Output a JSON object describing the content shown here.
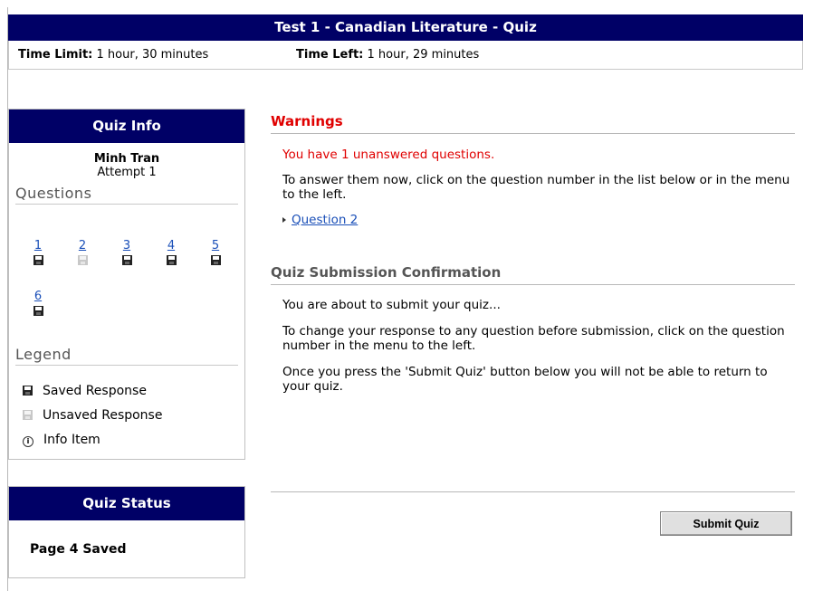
{
  "header": {
    "title": "Test 1 - Canadian Literature - Quiz",
    "time_limit_label": "Time Limit:",
    "time_limit_value": "1 hour, 30 minutes",
    "time_left_label": "Time Left:",
    "time_left_value": "1 hour, 29 minutes"
  },
  "quiz_info": {
    "title": "Quiz Info",
    "user_name": "Minh Tran",
    "attempt": "Attempt 1",
    "questions_heading": "Questions",
    "questions": [
      {
        "number": "1",
        "status": "saved"
      },
      {
        "number": "2",
        "status": "unsaved"
      },
      {
        "number": "3",
        "status": "saved"
      },
      {
        "number": "4",
        "status": "saved"
      },
      {
        "number": "5",
        "status": "saved"
      },
      {
        "number": "6",
        "status": "saved"
      }
    ],
    "legend_heading": "Legend",
    "legend": {
      "saved": "Saved Response",
      "unsaved": "Unsaved Response",
      "info": "Info Item"
    }
  },
  "quiz_status": {
    "title": "Quiz Status",
    "text": "Page 4 Saved"
  },
  "warnings": {
    "title": "Warnings",
    "message": "You have 1 unanswered questions.",
    "instruction": "To answer them now, click on the question number in the list below or in the menu to the left.",
    "link": "Question 2"
  },
  "confirmation": {
    "title": "Quiz Submission Confirmation",
    "line1": "You are about to submit your quiz...",
    "line2": "To change your response to any question before submission, click on the question number in the menu to the left.",
    "line3": "Once you press the 'Submit Quiz' button below you will not be able to return to your quiz."
  },
  "submit_label": "Submit Quiz",
  "colors": {
    "header_bg": "#000066",
    "warning": "#e00000",
    "link": "#1a4fb8"
  }
}
